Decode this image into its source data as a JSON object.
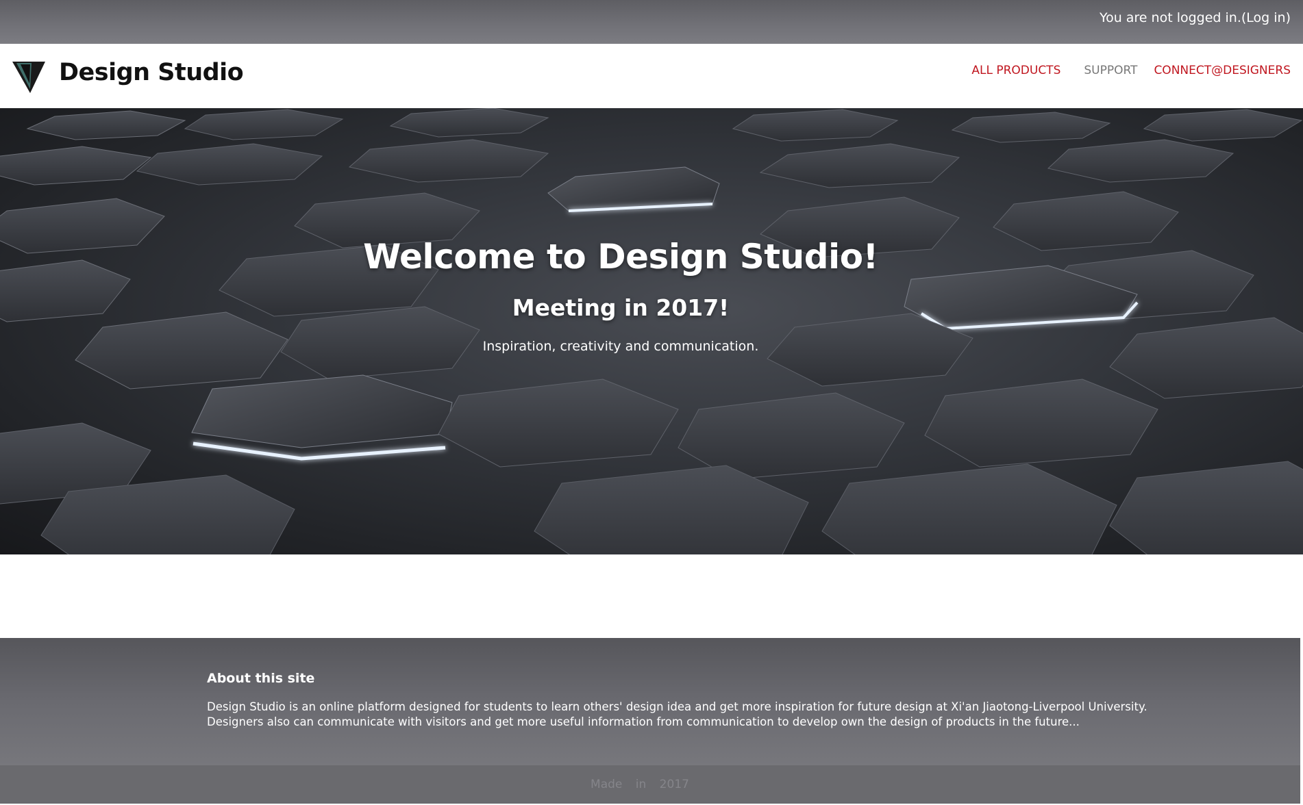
{
  "topbar": {
    "status_text": "You are not logged in.",
    "login_link": "(Log in)"
  },
  "header": {
    "logo_icon": "triangle-logo-icon",
    "site_title": "Design Studio",
    "nav": [
      {
        "label": "ALL PRODUCTS",
        "color": "#c0161f"
      },
      {
        "label": "SUPPORT",
        "color": "#777777"
      },
      {
        "label": "CONNECT@DESIGNERS",
        "color": "#c0161f"
      }
    ]
  },
  "hero": {
    "title": "Welcome to Design Studio!",
    "subtitle": "Meeting in 2017!",
    "tagline": "Inspiration, creativity and communication.",
    "background_image": "dark hexagon tiles with glowing edges"
  },
  "about": {
    "heading": "About this site",
    "text": "Design Studio is an online platform designed for students to learn others' design idea and get more inspiration for future design at Xi'an Jiaotong-Liverpool University. Designers also can communicate with visitors and get more useful information from communication to develop own the design of products in the future..."
  },
  "footer": {
    "text": "Made in 2017"
  },
  "colors": {
    "accent": "#c0161f",
    "bar_gray": "#6e6e73",
    "hero_dark": "#2a2c31"
  }
}
